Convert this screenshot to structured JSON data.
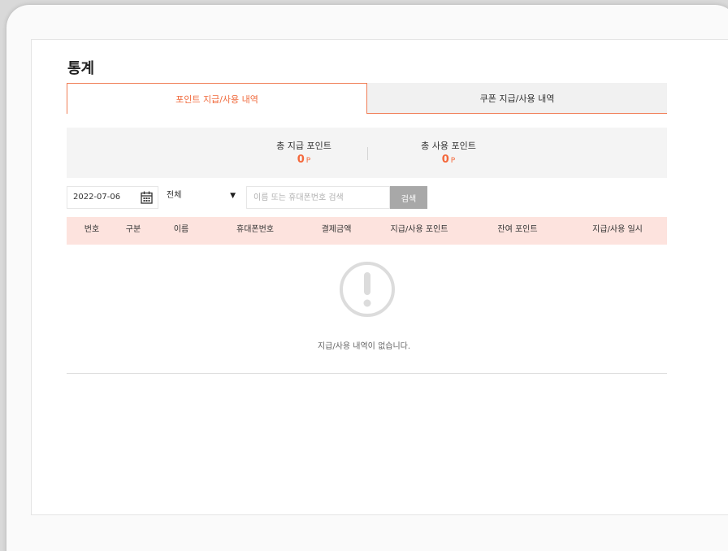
{
  "page": {
    "title": "통계"
  },
  "tabs": [
    {
      "label": "포인트 지급/사용 내역",
      "active": true
    },
    {
      "label": "쿠폰 지급/사용 내역",
      "active": false
    }
  ],
  "summary": {
    "issued": {
      "label": "총 지급 포인트",
      "value": "0",
      "unit": "P"
    },
    "used": {
      "label": "총 사용 포인트",
      "value": "0",
      "unit": "P"
    }
  },
  "filters": {
    "date": "2022-07-06",
    "date_icon": "calendar-icon",
    "type_select": "전체",
    "search_placeholder": "이름 또는 휴대폰번호 검색",
    "search_button": "검색"
  },
  "table": {
    "columns": [
      "번호",
      "구분",
      "이름",
      "휴대폰번호",
      "결제금액",
      "지급/사용 포인트",
      "잔여 포인트",
      "지급/사용 일시"
    ],
    "rows": []
  },
  "empty_state": {
    "icon": "exclamation-circle-icon",
    "message": "지급/사용 내역이 없습니다."
  },
  "colors": {
    "accent": "#f06a3c",
    "header_bg": "#fde3de",
    "summary_bg": "#f4f4f4",
    "button_bg": "#a8a8a8"
  }
}
